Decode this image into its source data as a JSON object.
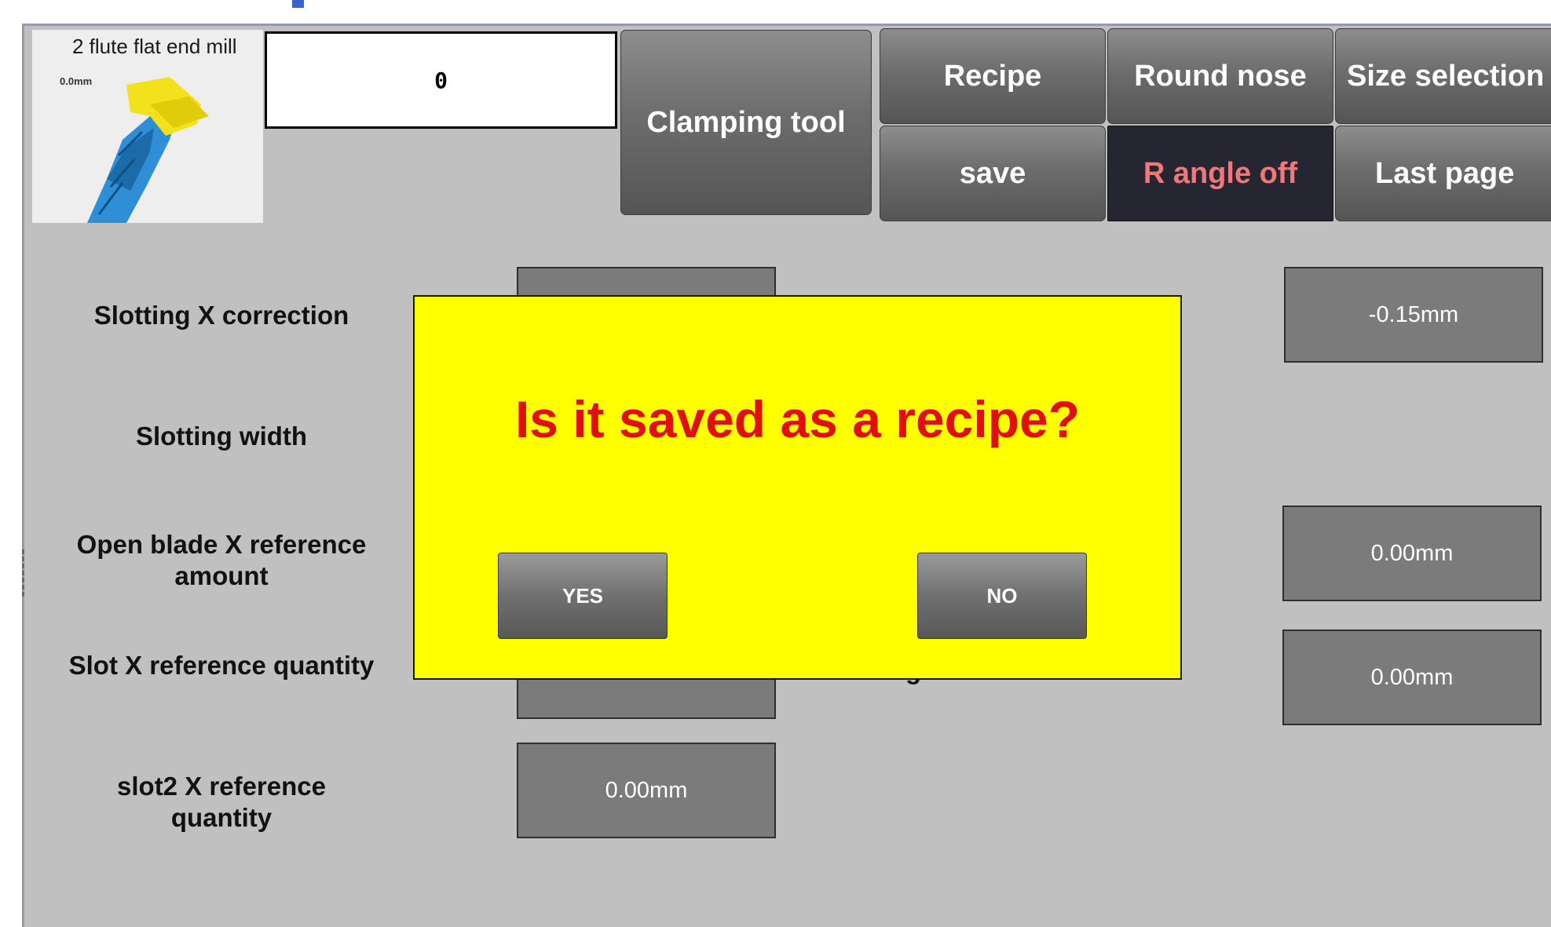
{
  "tool": {
    "name": "2 flute flat end mill",
    "dimension": "0.0mm",
    "number": "0"
  },
  "buttons": {
    "clamping_tool": "Clamping tool",
    "recipe": "Recipe",
    "round_nose": "Round nose",
    "size_selection": "Size selection",
    "save": "save",
    "r_angle_off": "R angle off",
    "last_page": "Last page"
  },
  "params": {
    "slotting_x_correction": "Slotting X correction",
    "slotting_width": "Slotting width",
    "open_blade_x_reference_amount": "Open blade X reference amount",
    "slot_x_reference_quantity": "Slot X reference quantity",
    "slot2_x_reference_quantity": "slot2 X reference quantity",
    "slotting_x_feed_amount": "Slotting X feed amount"
  },
  "values": {
    "slot2_x_reference": "0.00mm",
    "right_1": "-0.15mm",
    "right_2": "0.00mm",
    "right_3": "0.00mm"
  },
  "dialog": {
    "message": "Is it saved as a recipe?",
    "yes": "YES",
    "no": "NO"
  },
  "colors": {
    "panel_bg": "#c0c0c0",
    "dialog_bg": "#ffff00",
    "dialog_text": "#e01010",
    "r_angle_text": "#f07878"
  }
}
